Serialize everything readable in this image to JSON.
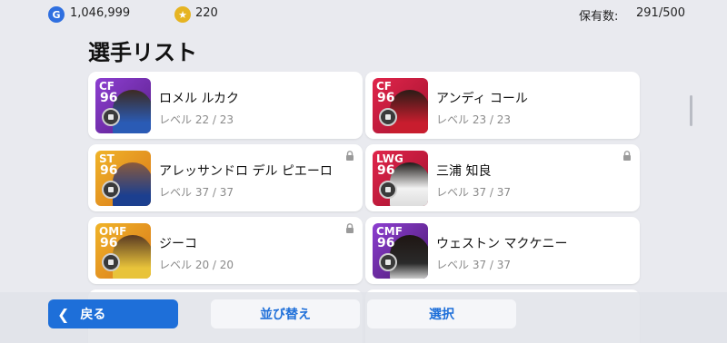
{
  "topbar": {
    "gp_icon": "G",
    "gp_value": "1,046,999",
    "coin_icon": "★",
    "coin_value": "220",
    "storage_label": "保有数:",
    "storage_value": "291/500"
  },
  "title": "選手リスト",
  "players": [
    {
      "position": "CF",
      "rating": "96",
      "name": "ロメル ルカク",
      "level": "レベル 22 / 23",
      "locked": false,
      "card_color": "#7b2fbf"
    },
    {
      "position": "CF",
      "rating": "96",
      "name": "アンディ コール",
      "level": "レベル 23 / 23",
      "locked": false,
      "card_color": "#c0183a"
    },
    {
      "position": "ST",
      "rating": "96",
      "name": "アレッサンドロ デル ピエーロ",
      "level": "レベル 37 / 37",
      "locked": true,
      "card_color": "#7b2fbf"
    },
    {
      "position": "LWG",
      "rating": "96",
      "name": "三浦 知良",
      "level": "レベル 37 / 37",
      "locked": true,
      "card_color": "#c0183a"
    },
    {
      "position": "OMF",
      "rating": "96",
      "name": "ジーコ",
      "level": "レベル 20 / 20",
      "locked": true,
      "card_color": "#7b2fbf"
    },
    {
      "position": "CMF",
      "rating": "96",
      "name": "ウェストン マクケニー",
      "level": "レベル 37 / 37",
      "locked": false,
      "card_color": "#5a1f8a"
    }
  ],
  "buttons": {
    "back": "戻る",
    "sort": "並び替え",
    "select": "選択"
  },
  "colors": {
    "accent": "#1e6fd9",
    "background": "#e9eaef"
  }
}
